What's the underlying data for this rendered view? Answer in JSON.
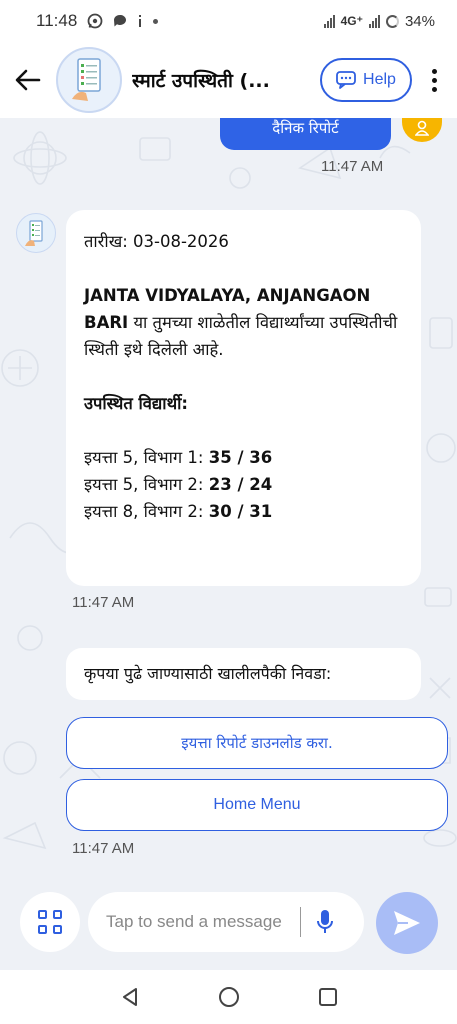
{
  "status_bar": {
    "time": "11:48",
    "network": "4G⁺",
    "battery": "34%",
    "icons": [
      "whatsapp-icon",
      "chat-icon",
      "info-icon",
      "dot-icon",
      "signal-icon",
      "battery-icon"
    ]
  },
  "header": {
    "title": "स्मार्ट उपस्थिती (...",
    "help_label": "Help",
    "icons": [
      "back-arrow-icon",
      "help-chat-icon",
      "kebab-menu-icon"
    ]
  },
  "chat": {
    "previous_user_message": "दैनिक रिपोर्ट",
    "previous_time": "11:47 AM",
    "report": {
      "date_line": "तारीख: 03-08-2026",
      "school_name": "JANTA VIDYALAYA, ANJANGAON BARI",
      "school_suffix": " या तुमच्या शाळेतील विद्यार्थ्यांच्या उपस्थितीची स्थिती इथे दिलेली आहे.",
      "present_heading": "उपस्थित विद्यार्थी:",
      "rows": [
        {
          "label": "इयत्ता 5, विभाग 1: ",
          "value": "35 / 36"
        },
        {
          "label": "इयत्ता 5, विभाग 2: ",
          "value": "23 / 24"
        },
        {
          "label": "इयत्ता 8, विभाग 2: ",
          "value": "30 / 31"
        }
      ],
      "time": "11:47 AM"
    },
    "prompt": {
      "text": "कृपया पुढे जाण्यासाठी खालीलपैकी निवडा:",
      "options": [
        "इयत्ता रिपोर्ट डाउनलोड करा.",
        "Home Menu"
      ],
      "time": "11:47 AM"
    }
  },
  "composer": {
    "placeholder": "Tap to send a message",
    "icons": [
      "menu-grid-icon",
      "microphone-icon",
      "send-icon"
    ]
  },
  "nav_bar": {
    "icons": [
      "nav-back-icon",
      "nav-home-icon",
      "nav-recents-icon"
    ]
  },
  "colors": {
    "accent": "#2f5fe0",
    "chat_background": "#eef1f6",
    "user_bubble": "#2f63e6",
    "user_avatar": "#f7b500",
    "send_disabled": "#a9bdf6"
  }
}
